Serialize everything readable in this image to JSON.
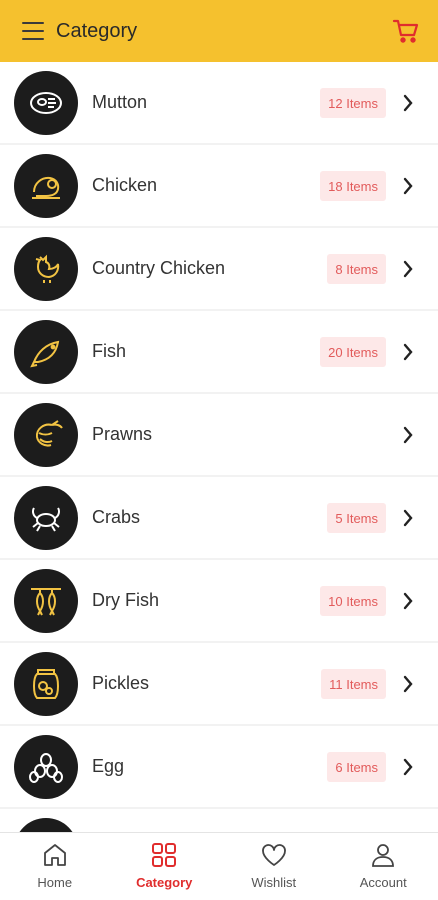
{
  "header": {
    "title": "Category",
    "menu_icon": "hamburger-menu-icon",
    "cart_icon": "cart-icon",
    "accent": "#f5c12e"
  },
  "categories": [
    {
      "label": "Mutton",
      "badge": "12 Items",
      "icon": "steak-icon"
    },
    {
      "label": "Chicken",
      "badge": "18 Items",
      "icon": "roast-chicken-icon"
    },
    {
      "label": "Country Chicken",
      "badge": "8 Items",
      "icon": "rooster-icon"
    },
    {
      "label": "Fish",
      "badge": "20 Items",
      "icon": "fish-icon"
    },
    {
      "label": "Prawns",
      "badge": "",
      "icon": "prawn-icon"
    },
    {
      "label": "Crabs",
      "badge": "5 Items",
      "icon": "crab-icon"
    },
    {
      "label": "Dry Fish",
      "badge": "10 Items",
      "icon": "dry-fish-icon"
    },
    {
      "label": "Pickles",
      "badge": "11 Items",
      "icon": "pickle-jar-icon"
    },
    {
      "label": "Egg",
      "badge": "6 Items",
      "icon": "eggs-icon"
    }
  ],
  "bottom_nav": [
    {
      "label": "Home",
      "icon": "home-icon"
    },
    {
      "label": "Category",
      "icon": "grid-icon",
      "active": true
    },
    {
      "label": "Wishlist",
      "icon": "heart-icon"
    },
    {
      "label": "Account",
      "icon": "user-icon"
    }
  ],
  "colors": {
    "badge_bg": "#fde8e8",
    "badge_text": "#e25b5b",
    "active_nav": "#e02d2d",
    "icon_gold": "#f2c343"
  }
}
